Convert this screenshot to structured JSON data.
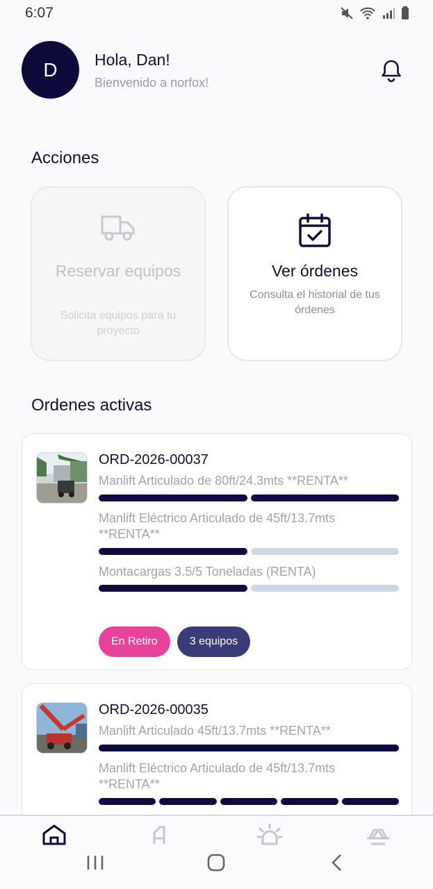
{
  "status": {
    "time": "6:07"
  },
  "header": {
    "avatar_initial": "D",
    "greeting": "Hola, Dan!",
    "welcome": "Bienvenido a norfox!"
  },
  "actions": {
    "title": "Acciones",
    "reserve": {
      "title": "Reservar equipos",
      "description": "Solicita equipos para tu proyecto",
      "enabled": false
    },
    "orders": {
      "title": "Ver órdenes",
      "description": "Consulta el historial de tus órdenes",
      "enabled": true
    }
  },
  "active_orders": {
    "title": "Ordenes activas",
    "orders": [
      {
        "id": "ORD-2026-00037",
        "items": [
          {
            "name": "Manlift Articulado de 80ft/24.3mts **RENTA**",
            "progress_filled": 2,
            "progress_total": 2
          },
          {
            "name": "Manlift Eléctrico Articulado de 45ft/13.7mts **RENTA**",
            "progress_filled": 1,
            "progress_total": 2
          },
          {
            "name": "Montacargas 3.5/5 Toneladas (RENTA)",
            "progress_filled": 1,
            "progress_total": 2
          }
        ],
        "status": "En Retiro",
        "equipment_count": "3 equipos"
      },
      {
        "id": "ORD-2026-00035",
        "items": [
          {
            "name": "Manlift Articulado 45ft/13.7mts **RENTA**",
            "progress_filled": 1,
            "progress_total": 1
          },
          {
            "name": "Manlift Eléctrico Articulado de 45ft/13.7mts **RENTA**",
            "progress_filled": 5,
            "progress_total": 5
          }
        ]
      }
    ]
  },
  "bottom_nav": {
    "items": [
      {
        "icon": "home-icon",
        "active": true
      },
      {
        "icon": "orders-icon",
        "active": false
      },
      {
        "icon": "alert-icon",
        "active": false
      },
      {
        "icon": "equipment-icon",
        "active": false
      }
    ]
  },
  "colors": {
    "primary": "#0d0a3b",
    "status_pink": "#e8439b",
    "chip_navy": "#3b3b78",
    "progress_empty": "#cfd8e2"
  }
}
